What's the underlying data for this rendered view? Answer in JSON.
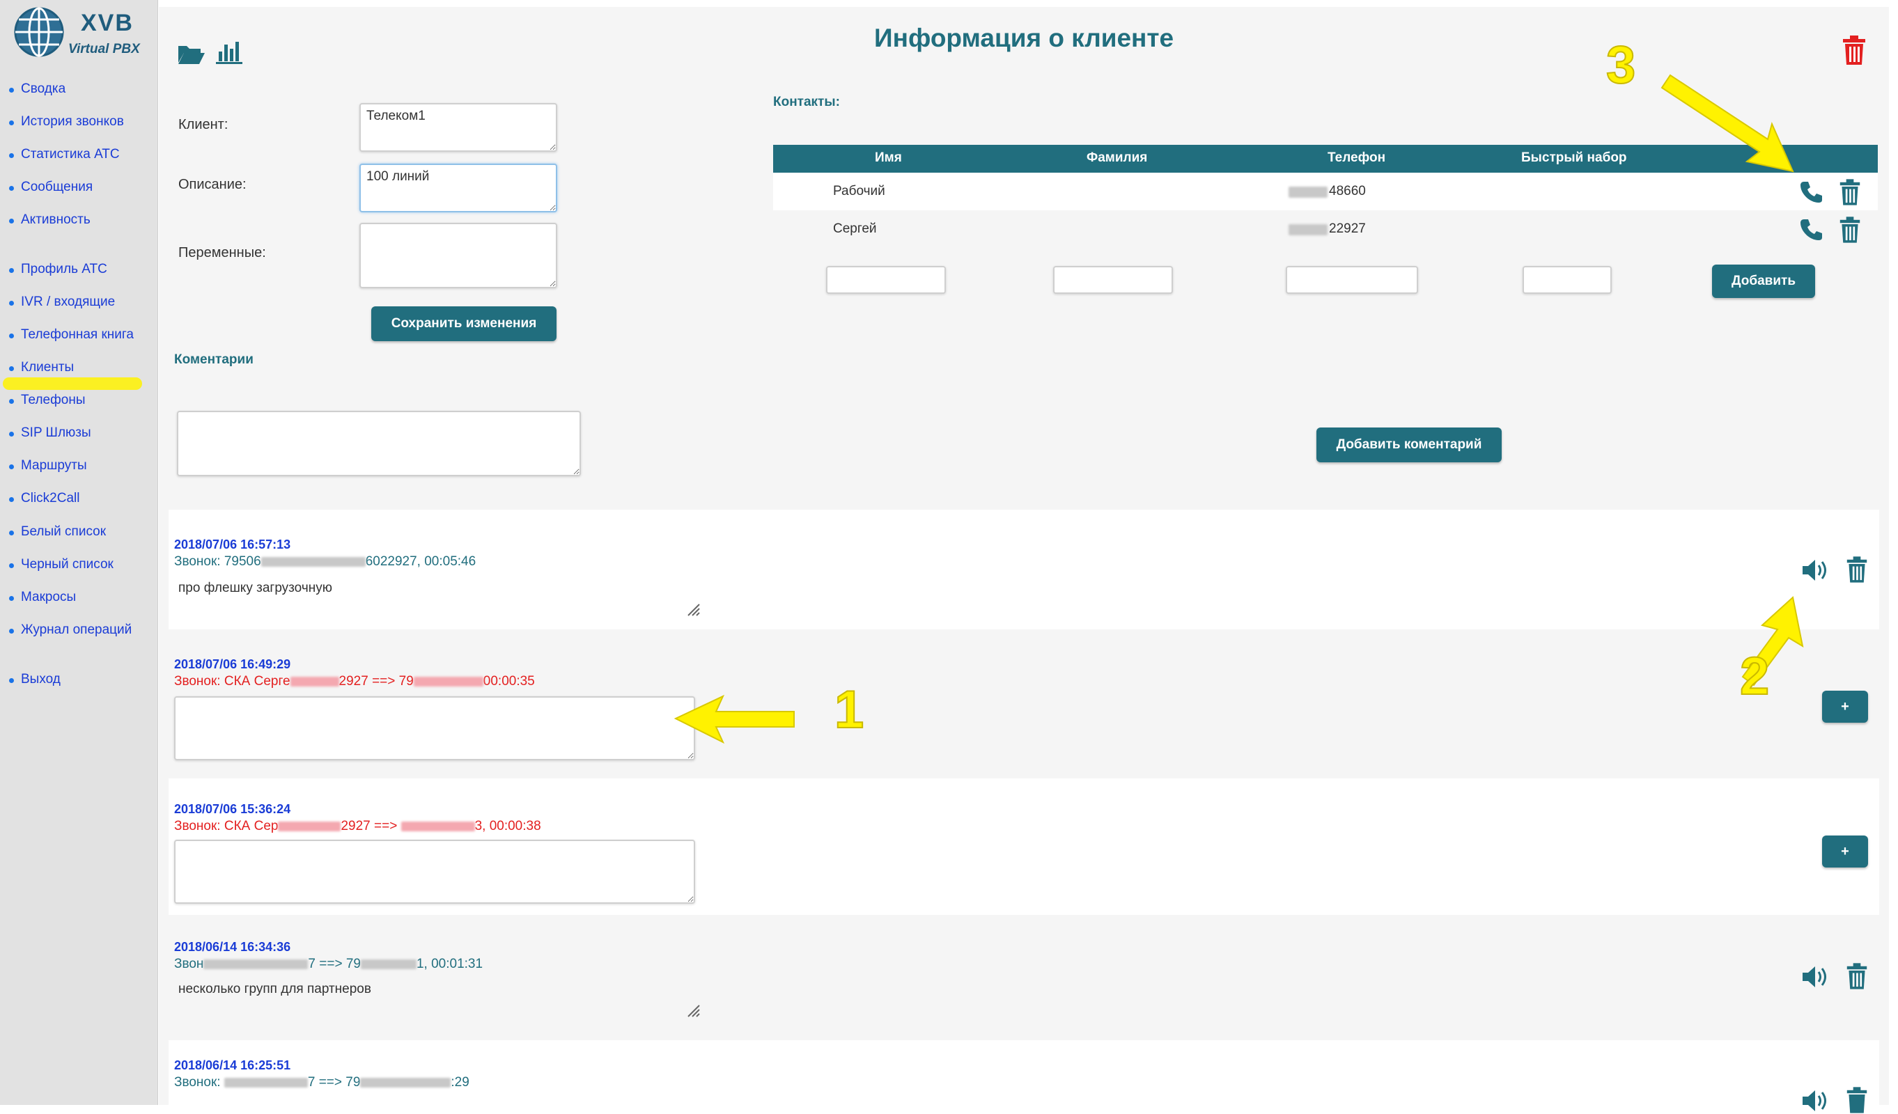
{
  "app": {
    "title": "XVB",
    "subtitle": "Virtual PBX"
  },
  "sidebar": {
    "items": [
      {
        "label": "Сводка"
      },
      {
        "label": "История звонков"
      },
      {
        "label": "Статистика АТС"
      },
      {
        "label": "Сообщения"
      },
      {
        "label": "Активность"
      },
      {
        "label": "Профиль АТС"
      },
      {
        "label": "IVR / входящие"
      },
      {
        "label": "Телефонная книга"
      },
      {
        "label": "Клиенты"
      },
      {
        "label": "Телефоны"
      },
      {
        "label": "SIP Шлюзы"
      },
      {
        "label": "Маршруты"
      },
      {
        "label": "Click2Call"
      },
      {
        "label": "Белый список"
      },
      {
        "label": "Черный список"
      },
      {
        "label": "Макросы"
      },
      {
        "label": "Журнал операций"
      },
      {
        "label": "Выход"
      }
    ],
    "active": "Клиенты"
  },
  "page": {
    "title": "Информация о клиенте"
  },
  "form": {
    "client_label": "Клиент:",
    "client_value": "Телеком1",
    "description_label": "Описание:",
    "description_value": "100 линий",
    "variables_label": "Переменные:",
    "variables_value": "",
    "save_button": "Сохранить изменения"
  },
  "comments": {
    "label": "Коментарии",
    "add_button": "Добавить коментарий"
  },
  "contacts": {
    "label": "Контакты:",
    "columns": [
      "Имя",
      "Фамилия",
      "Телефон",
      "Быстрый набор"
    ],
    "rows": [
      {
        "name": "Рабочий",
        "surname": "",
        "phone_suffix": "48660",
        "speed_dial": ""
      },
      {
        "name": "Сергей",
        "surname": "",
        "phone_suffix": "22927",
        "speed_dial": ""
      }
    ],
    "add_button": "Добавить"
  },
  "log": [
    {
      "timestamp": "2018/07/06 16:57:13",
      "call_prefix": "Звонок: 79506",
      "call_suffix": "6022927, 00:05:46",
      "note": "про флешку загрузочную",
      "style": "teal"
    },
    {
      "timestamp": "2018/07/06 16:49:29",
      "call_prefix": "Звонок: СКА Серге",
      "call_middle": "2927 ==> 79",
      "call_suffix": "00:00:35",
      "note": "",
      "style": "red"
    },
    {
      "timestamp": "2018/07/06 15:36:24",
      "call_prefix": "Звонок: СКА Сер",
      "call_middle": "2927 ==> ",
      "call_suffix": "3, 00:00:38",
      "note": "",
      "style": "red"
    },
    {
      "timestamp": "2018/06/14 16:34:36",
      "call_prefix": "Звон",
      "call_middle": "7 ==> 79",
      "call_suffix": "1, 00:01:31",
      "note": "несколько групп для партнеров",
      "style": "teal"
    },
    {
      "timestamp": "2018/06/14 16:25:51",
      "call_prefix": "Звонок: ",
      "call_middle": "7 ==> 79",
      "call_suffix": ":29",
      "note": "",
      "style": "teal"
    }
  ],
  "plus_label": "+",
  "annotations": [
    "1",
    "2",
    "3"
  ],
  "colors": {
    "accent": "#216e7e",
    "link": "#1a3cd6",
    "alert": "#e32020",
    "highlight": "#fff200"
  }
}
